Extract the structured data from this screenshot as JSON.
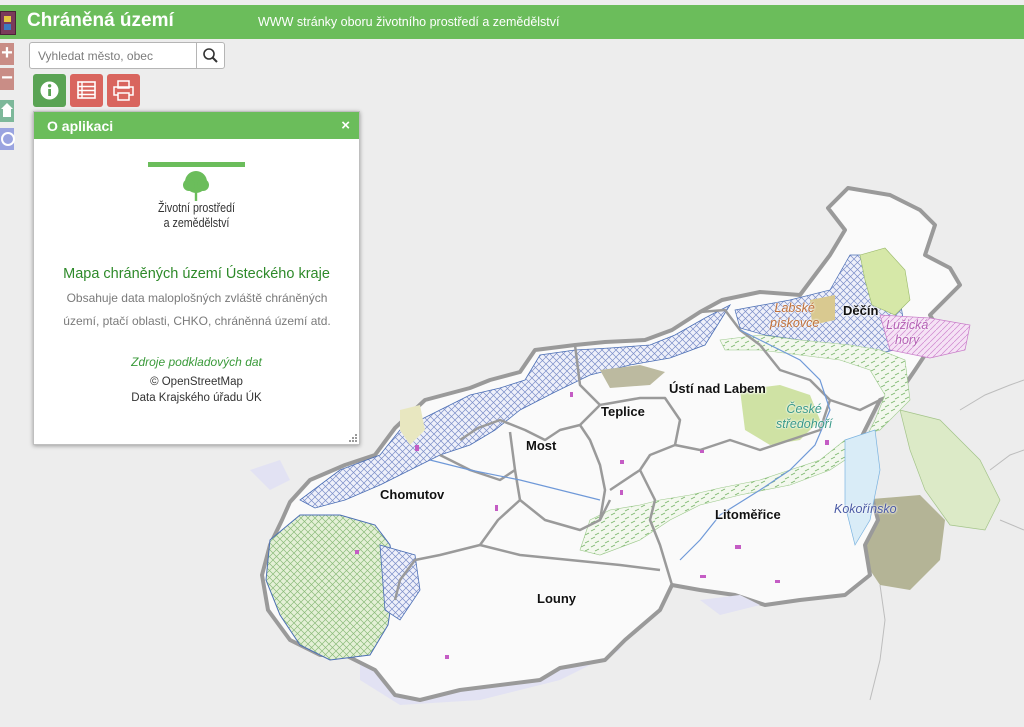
{
  "header": {
    "title": "Chráněná území",
    "subtitle": "WWW stránky oboru životního prostředí a zemědělství"
  },
  "controls": {
    "zoom_in": "+",
    "zoom_out": "−",
    "search_placeholder": "Vyhledat město, obec"
  },
  "colors": {
    "header": "#6bbd5b",
    "info_button": "#5aa354",
    "layers_button": "#d9655e",
    "print_button": "#d9655e"
  },
  "panel": {
    "title": "O aplikaci",
    "close": "×",
    "logo_line1": "Životní prostředí",
    "logo_line2": "a zemědělství",
    "heading": "Mapa chráněných území Ústeckého kraje",
    "description": "Obsahuje data maloplošných zvláště chráněných území, ptačí oblasti, CHKO, chráněnná území atd.",
    "sources_link": "Zdroje podkladových dat",
    "credit_osm": "© OpenStreetMap",
    "credit_kraj": "Data Krajského úřadu ÚK"
  },
  "map": {
    "towns": [
      "Děčín",
      "Ústí nad Labem",
      "Teplice",
      "Most",
      "Chomutov",
      "Litoměřice",
      "Louny"
    ],
    "protected_areas": [
      {
        "line1": "Labské",
        "line2": "pískovce",
        "color": "#c0703a"
      },
      {
        "line1": "Lužická",
        "line2": "hory",
        "color": "#b45fb4"
      },
      {
        "line1": "České",
        "line2": "středohoří",
        "color": "#3b9a8a"
      },
      {
        "line1": "Kokořínsko",
        "line2": "",
        "color": "#4a5aa5"
      }
    ]
  }
}
